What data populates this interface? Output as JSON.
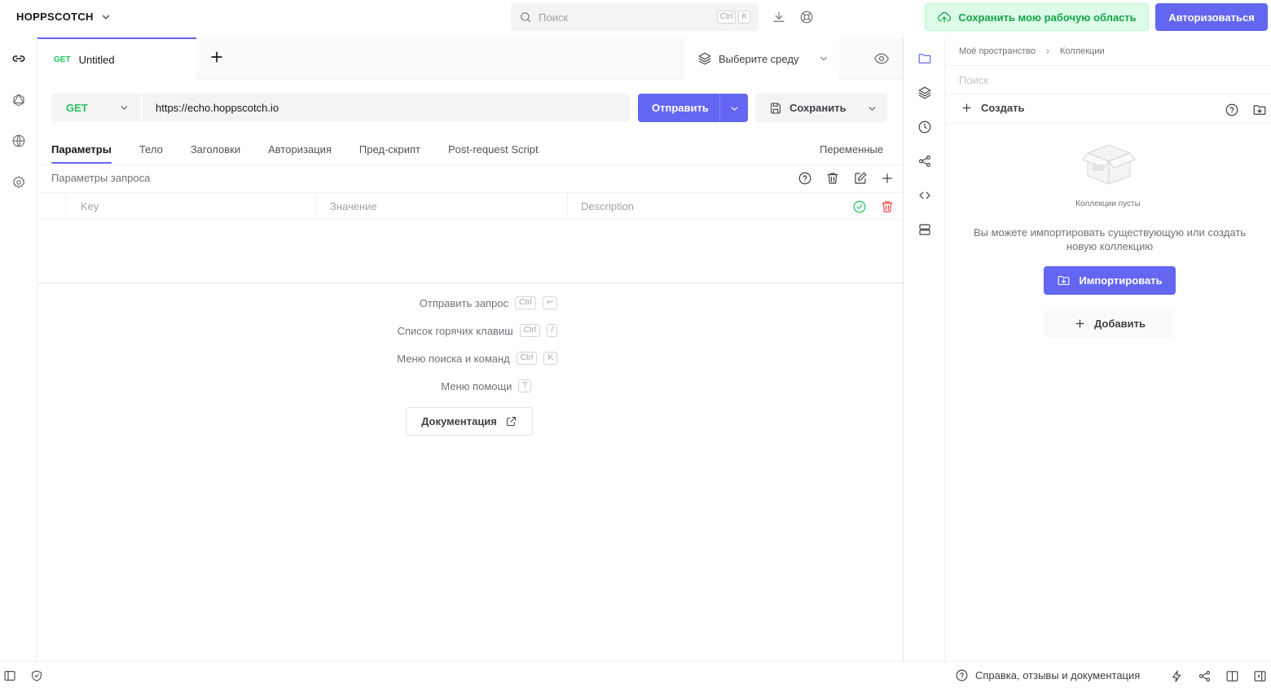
{
  "header": {
    "brand": "HOPPSCOTCH",
    "search_placeholder": "Поиск",
    "search_kbd": [
      "Ctrl",
      "K"
    ],
    "save_workspace": "Сохранить мою рабочую область",
    "login": "Авторизоваться"
  },
  "tab": {
    "method": "GET",
    "title": "Untitled"
  },
  "environment": {
    "label": "Выберите среду"
  },
  "request": {
    "method": "GET",
    "url": "https://echo.hoppscotch.io",
    "send": "Отправить",
    "save": "Сохранить"
  },
  "subtabs": [
    "Параметры",
    "Тело",
    "Заголовки",
    "Авторизация",
    "Пред-скрипт",
    "Post-request Script"
  ],
  "variables_tab": "Переменные",
  "params": {
    "title": "Параметры запроса",
    "columns": {
      "key": "Key",
      "value": "Значение",
      "description": "Description"
    }
  },
  "shortcuts": [
    {
      "label": "Отправить запрос",
      "keys": [
        "Ctrl",
        "↩"
      ]
    },
    {
      "label": "Список горячих клавиш",
      "keys": [
        "Ctrl",
        "/"
      ]
    },
    {
      "label": "Меню поиска и команд",
      "keys": [
        "Ctrl",
        "K"
      ]
    },
    {
      "label": "Меню помощи",
      "keys": [
        "?"
      ]
    }
  ],
  "docs_button": "Документация",
  "collections": {
    "breadcrumb": [
      "Моё пространство",
      "Коллекции"
    ],
    "search_placeholder": "Поиск",
    "create": "Создать",
    "empty_title": "Коллекции пусты",
    "empty_desc": "Вы можете импортировать существующую или создать новую коллекцию",
    "import": "Импортировать",
    "add": "Добавить"
  },
  "footer": {
    "help": "Справка, отзывы и документация"
  },
  "colors": {
    "accent": "#6366f1",
    "success": "#22c55e",
    "danger": "#ef4444"
  }
}
